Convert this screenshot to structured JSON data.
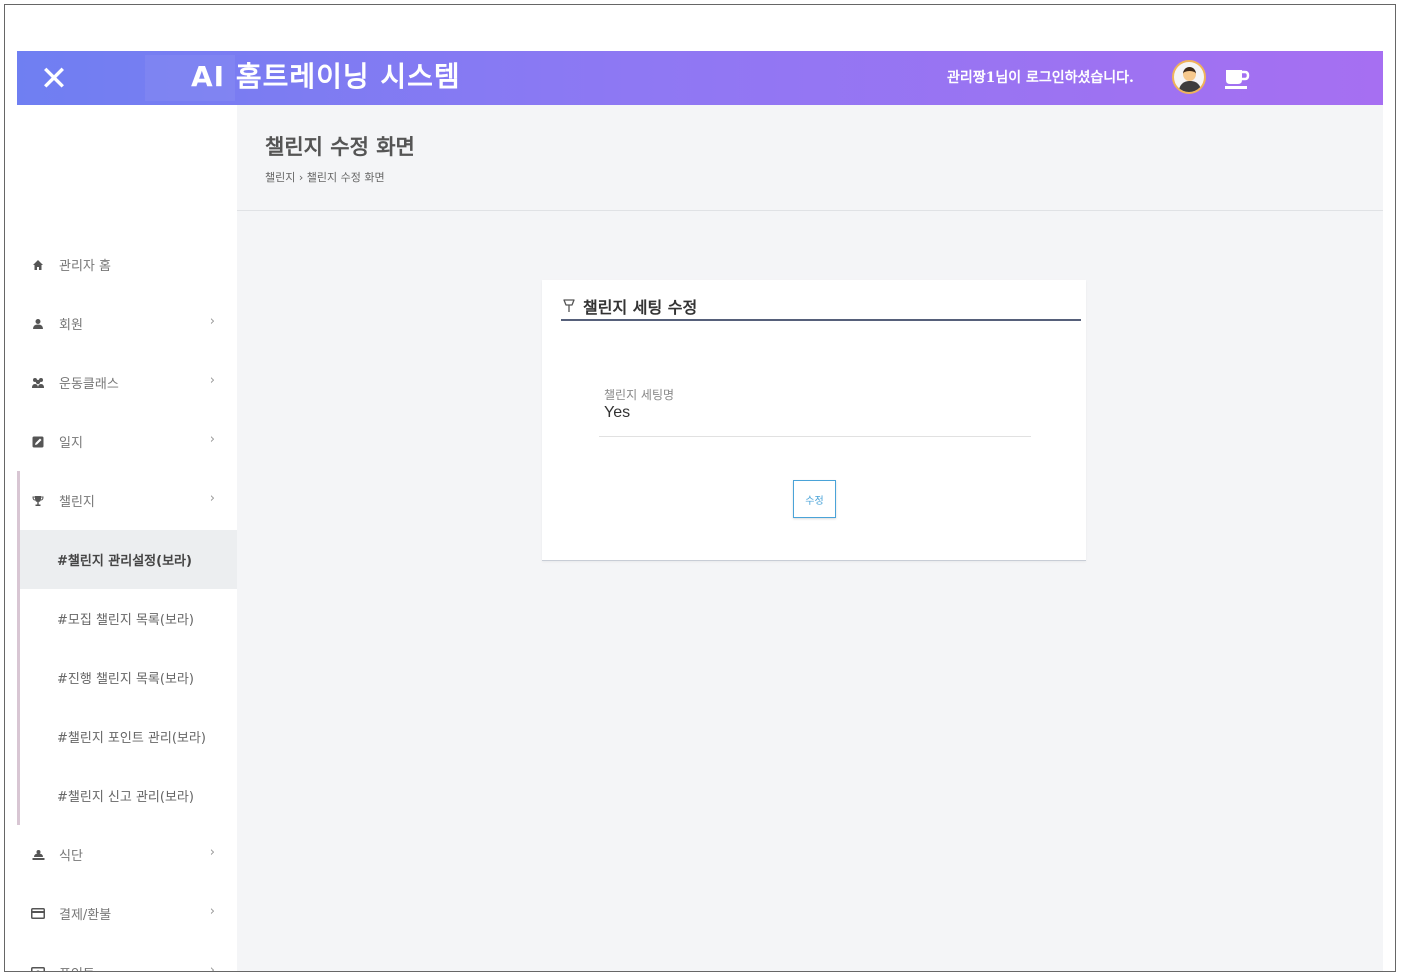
{
  "header": {
    "title": "AI 홈트레이닝 시스템",
    "login_message": "관리짱1님이 로그인하셨습니다.",
    "close_label": "✕"
  },
  "colors": {
    "header_gradient_start": "#6f7ff2",
    "header_gradient_end": "#a66ff2",
    "accent": "#4aa3d8",
    "active_bg": "#eceef0"
  },
  "sidebar": {
    "items": [
      {
        "label": "관리자 홈",
        "icon": "home-icon",
        "arrow": ""
      },
      {
        "label": "회원",
        "icon": "user-icon",
        "arrow": "›"
      },
      {
        "label": "운동클래스",
        "icon": "users-icon",
        "arrow": "›"
      },
      {
        "label": "일지",
        "icon": "edit-icon",
        "arrow": "›"
      },
      {
        "label": "챌린지",
        "icon": "trophy-icon",
        "arrow": "›"
      }
    ],
    "challenge_sub": [
      "#챌린지 관리설정(보라)",
      "#모집 챌린지 목록(보라)",
      "#진행 챌린지 목록(보라)",
      "#챌린지 포인트 관리(보라)",
      "#챌린지 신고 관리(보라)"
    ],
    "items_after": [
      {
        "label": "식단",
        "icon": "food-icon",
        "arrow": "›"
      },
      {
        "label": "결제/환불",
        "icon": "credit-card-icon",
        "arrow": "›"
      },
      {
        "label": "포인트",
        "icon": "point-icon",
        "arrow": "›"
      }
    ]
  },
  "page": {
    "title": "챌린지 수정 화면",
    "breadcrumb": "챌린지 › 챌린지 수정 화면"
  },
  "card": {
    "title": "챌린지 세팅 수정",
    "field_label": "챌린지 세팅명",
    "field_value": "Yes",
    "button_label": "수정"
  }
}
